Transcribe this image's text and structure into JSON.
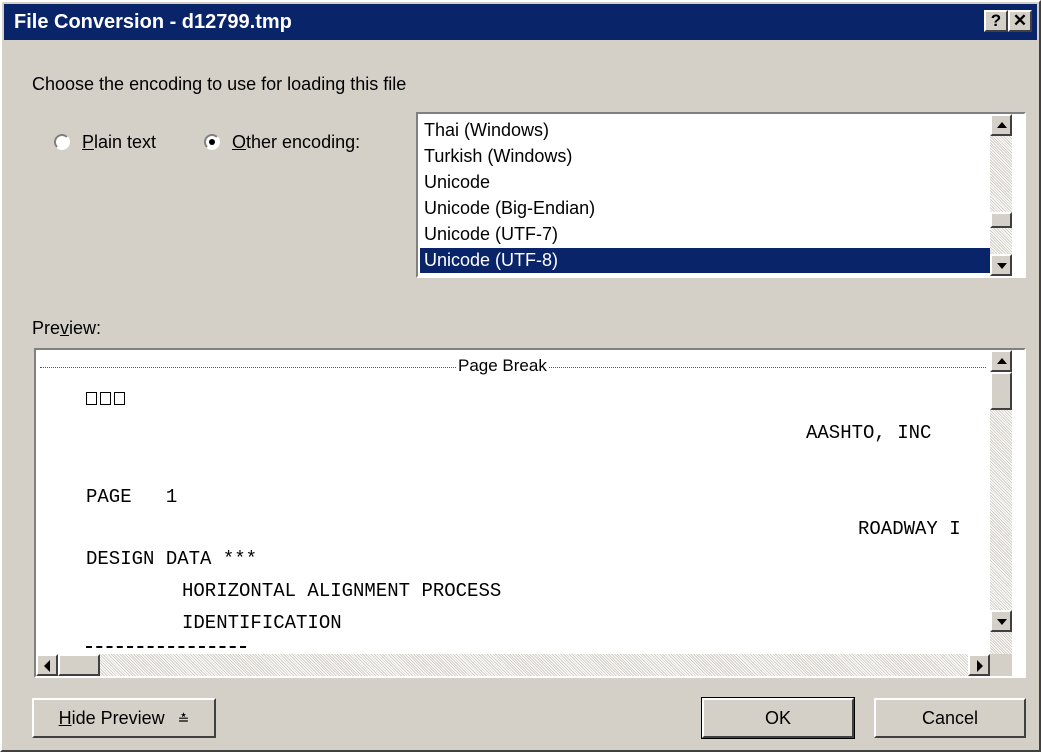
{
  "window": {
    "title": "File Conversion - d12799.tmp",
    "help_glyph": "?",
    "close_glyph": "✕"
  },
  "prompt": "Choose the encoding to use for loading this file",
  "radios": {
    "plain_text": {
      "access_key": "P",
      "rest": "lain text",
      "checked": false
    },
    "other_encoding": {
      "access_key": "O",
      "rest": "ther encoding:",
      "checked": true
    }
  },
  "encodings": {
    "items": [
      "Thai (Windows)",
      "Turkish (Windows)",
      "Unicode",
      "Unicode (Big-Endian)",
      "Unicode (UTF-7)",
      "Unicode (UTF-8)"
    ],
    "selected": "Unicode (UTF-8)"
  },
  "preview": {
    "label_pre": "Pre",
    "label_key": "v",
    "label_post": "iew:",
    "page_break": "Page Break",
    "lines": [
      "AASHTO, INC",
      "PAGE   1",
      "ROADWAY I",
      "DESIGN DATA ***",
      "HORIZONTAL ALIGNMENT PROCESS",
      "IDENTIFICATION"
    ]
  },
  "buttons": {
    "hide_preview_key": "H",
    "hide_preview_rest": "ide Preview",
    "hide_preview_glyph": "≛",
    "ok": "OK",
    "cancel": "Cancel"
  },
  "colors": {
    "title_bar": "#0a246a",
    "selection": "#0a246a",
    "face": "#d4d0c8"
  }
}
